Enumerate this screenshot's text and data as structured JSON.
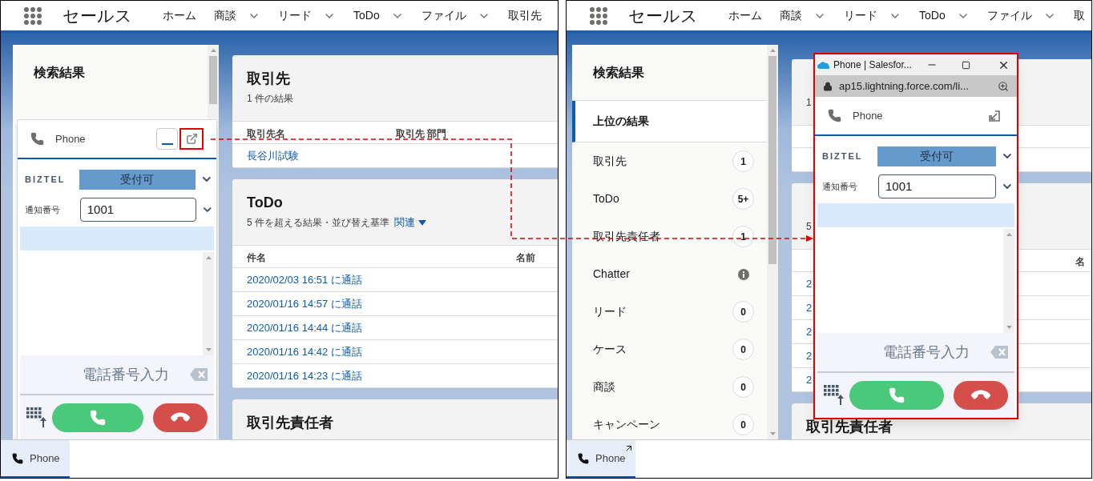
{
  "panels": [
    {
      "header": {
        "app_name": "セールス",
        "nav": [
          {
            "label": "ホーム",
            "menu": false
          },
          {
            "label": "商談",
            "menu": true
          },
          {
            "label": "リード",
            "menu": true
          },
          {
            "label": "ToDo",
            "menu": true
          },
          {
            "label": "ファイル",
            "menu": true
          },
          {
            "label": "取引先",
            "menu": false
          }
        ]
      },
      "search": {
        "title": "検索結果"
      },
      "cards": [
        {
          "title": "取引先",
          "subtitle": "1 件の結果",
          "columns": [
            "取引先名",
            "取引先 部門"
          ],
          "rows": [
            {
              "cells": [
                "長谷川試験"
              ]
            }
          ]
        },
        {
          "title": "ToDo",
          "subtitle": "5 件を超える結果・並び替え基準",
          "sort_link": "関連",
          "columns": [
            "件名",
            "名前"
          ],
          "rows": [
            {
              "cells": [
                "2020/02/03 16:51 に通話"
              ]
            },
            {
              "cells": [
                "2020/01/16 14:57 に通話"
              ]
            },
            {
              "cells": [
                "2020/01/16 14:44 に通話"
              ]
            },
            {
              "cells": [
                "2020/01/16 14:42 に通話"
              ]
            },
            {
              "cells": [
                "2020/01/16 14:23 に通話"
              ]
            }
          ]
        },
        {
          "title": "取引先責任者"
        }
      ],
      "phone": {
        "title": "Phone",
        "pop_out_highlighted": true,
        "brand": "BIZTEL",
        "status": "受付可",
        "caller_id_label": "通知番号",
        "caller_id": "1001",
        "dial_placeholder": "電話番号入力"
      },
      "utility_bar": {
        "tab": {
          "label": "Phone",
          "selected": true,
          "popped_out": false
        }
      }
    },
    {
      "header": {
        "app_name": "セールス",
        "nav": [
          {
            "label": "ホーム",
            "menu": false
          },
          {
            "label": "商談",
            "menu": true
          },
          {
            "label": "リード",
            "menu": true
          },
          {
            "label": "ToDo",
            "menu": true
          },
          {
            "label": "ファイル",
            "menu": true
          },
          {
            "label": "取",
            "menu": false
          }
        ]
      },
      "search": {
        "title": "検索結果",
        "items": [
          {
            "label": "上位の結果",
            "selected": true,
            "kind": "plain"
          },
          {
            "label": "取引先",
            "selected": false,
            "kind": "count",
            "count": "1"
          },
          {
            "label": "ToDo",
            "selected": false,
            "kind": "count",
            "count": "5+"
          },
          {
            "label": "取引先責任者",
            "selected": false,
            "kind": "count",
            "count": "1"
          },
          {
            "label": "Chatter",
            "selected": false,
            "kind": "info"
          },
          {
            "label": "リード",
            "selected": false,
            "kind": "count",
            "count": "0"
          },
          {
            "label": "ケース",
            "selected": false,
            "kind": "count",
            "count": "0"
          },
          {
            "label": "商談",
            "selected": false,
            "kind": "count",
            "count": "0"
          },
          {
            "label": "キャンペーン",
            "selected": false,
            "kind": "count",
            "count": "0"
          }
        ]
      },
      "cards": [
        {
          "subtitle": "1",
          "columns": [
            null
          ],
          "rows": [
            {
              "cells": [
                null
              ]
            }
          ]
        },
        {
          "subtitle": "5",
          "columns": [
            null,
            "名"
          ],
          "rows": [
            {
              "cells": [
                "2"
              ]
            },
            {
              "cells": [
                "2"
              ]
            },
            {
              "cells": [
                "2"
              ]
            },
            {
              "cells": [
                "2"
              ]
            },
            {
              "cells": [
                "2"
              ]
            }
          ]
        },
        {
          "title": "取引先責任者"
        }
      ],
      "phone": {
        "window": {
          "title": "Phone | Salesfor...",
          "url": "ap15.lightning.force.com/li...",
          "highlighted": true
        },
        "title": "Phone",
        "brand": "BIZTEL",
        "status": "受付可",
        "caller_id_label": "通知番号",
        "caller_id": "1001",
        "dial_placeholder": "電話番号入力"
      },
      "utility_bar": {
        "tab": {
          "label": "Phone",
          "selected": true,
          "popped_out": true
        }
      }
    }
  ]
}
